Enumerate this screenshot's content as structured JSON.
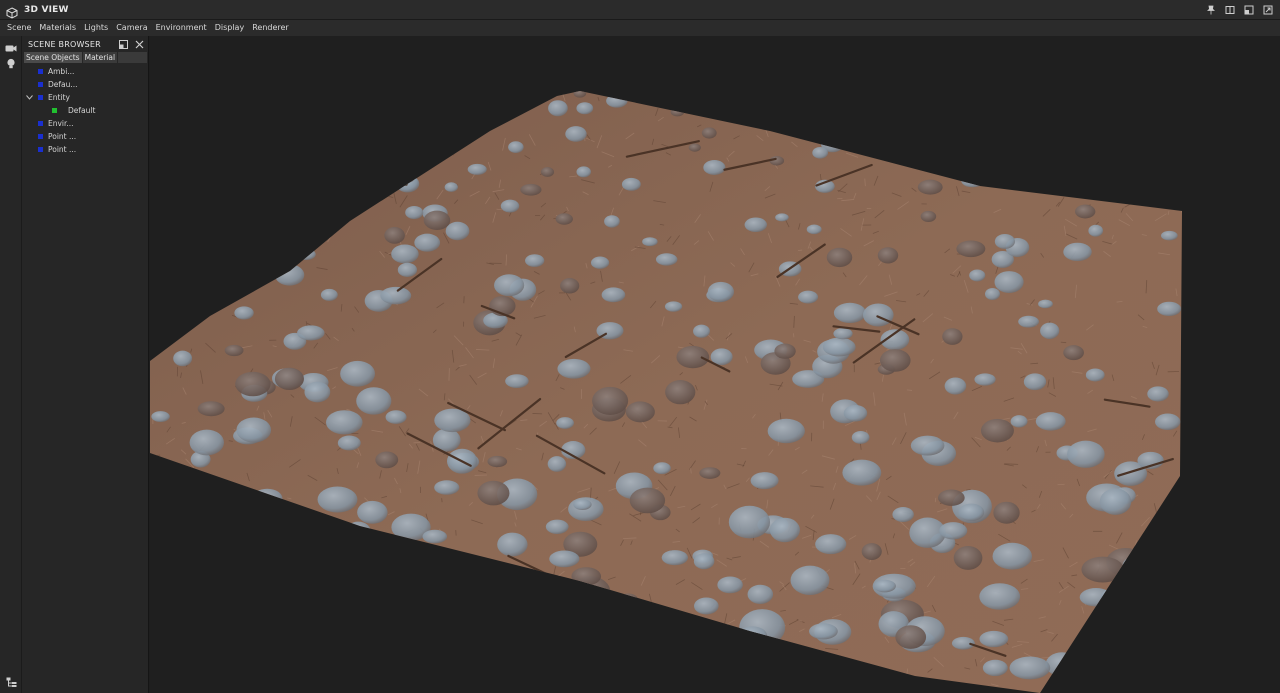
{
  "window": {
    "title": "3D VIEW",
    "icon": "cube-icon",
    "controls": [
      "pin-icon",
      "split-icon",
      "restore-icon",
      "close-icon"
    ]
  },
  "menu": {
    "items": [
      "Scene",
      "Materials",
      "Lights",
      "Camera",
      "Environment",
      "Display",
      "Renderer"
    ]
  },
  "toolstrip": {
    "tools": [
      "camera-icon",
      "light-bulb-icon"
    ],
    "bottom_tool": "hierarchy-icon"
  },
  "scene_browser": {
    "title": "SCENE BROWSER",
    "tabs": [
      "Scene Objects",
      "Material"
    ],
    "active_tab": 0,
    "items": [
      {
        "label": "Ambi...",
        "swatch": "#1a2fd0",
        "depth": 0,
        "expandable": false
      },
      {
        "label": "Defau...",
        "swatch": "#1a2fd0",
        "depth": 0,
        "expandable": false
      },
      {
        "label": "Entity",
        "swatch": "#1a2fd0",
        "depth": 0,
        "expandable": true
      },
      {
        "label": "Default",
        "swatch": "#21c030",
        "depth": 1,
        "expandable": false
      },
      {
        "label": "Envir...",
        "swatch": "#1a2fd0",
        "depth": 0,
        "expandable": false
      },
      {
        "label": "Point ...",
        "swatch": "#1a2fd0",
        "depth": 0,
        "expandable": false
      },
      {
        "label": "Point ...",
        "swatch": "#1a2fd0",
        "depth": 0,
        "expandable": false
      }
    ]
  },
  "viewport": {
    "background": "#1f1f1f",
    "ground_color": "#8a6652",
    "stone_color": "#8e9ba6",
    "twig_color": "#4a3326"
  }
}
